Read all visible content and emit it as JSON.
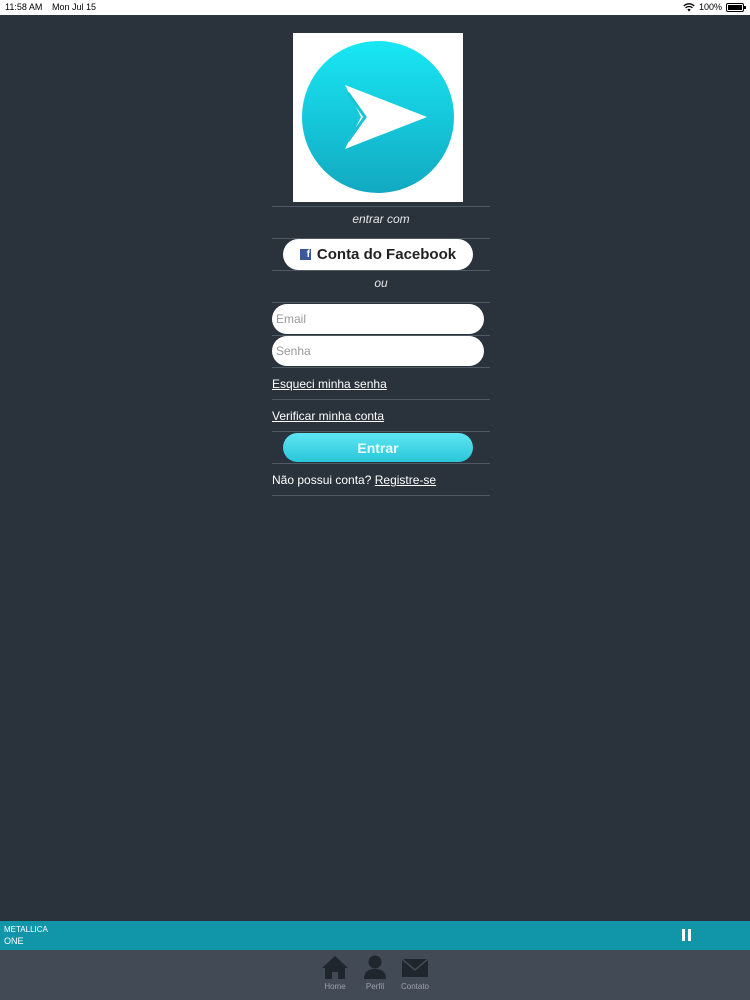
{
  "status_bar": {
    "time": "11:58 AM",
    "date": "Mon Jul 15",
    "battery": "100%",
    "icons": [
      "wifi-icon",
      "battery-icon"
    ]
  },
  "logo": {
    "icon": "play-arrow-logo-icon",
    "colors": {
      "circle_top": "#19e7f4",
      "circle_bottom": "#12a9c1"
    }
  },
  "login": {
    "enter_with": "entrar com",
    "facebook_button": "Conta do Facebook",
    "facebook_icon": "facebook-icon",
    "or_text": "ou",
    "email_placeholder": "Email",
    "password_placeholder": "Senha",
    "forgot_password": "Esqueci minha senha",
    "verify_account": "Verificar minha conta",
    "submit": "Entrar",
    "no_account": "Não possui conta?",
    "register": "Registre-se"
  },
  "player": {
    "artist": "METALLICA",
    "song": "ONE",
    "control_icon": "pause-icon"
  },
  "tab_bar": {
    "tabs": [
      {
        "label": "Home",
        "icon": "home-icon"
      },
      {
        "label": "Perfil",
        "icon": "profile-icon"
      },
      {
        "label": "Contato",
        "icon": "mail-icon"
      }
    ]
  },
  "colors": {
    "background": "#2a323c",
    "accent": "#29c6d9",
    "player_bar": "#1195a9",
    "tab_bar": "#424a55"
  }
}
